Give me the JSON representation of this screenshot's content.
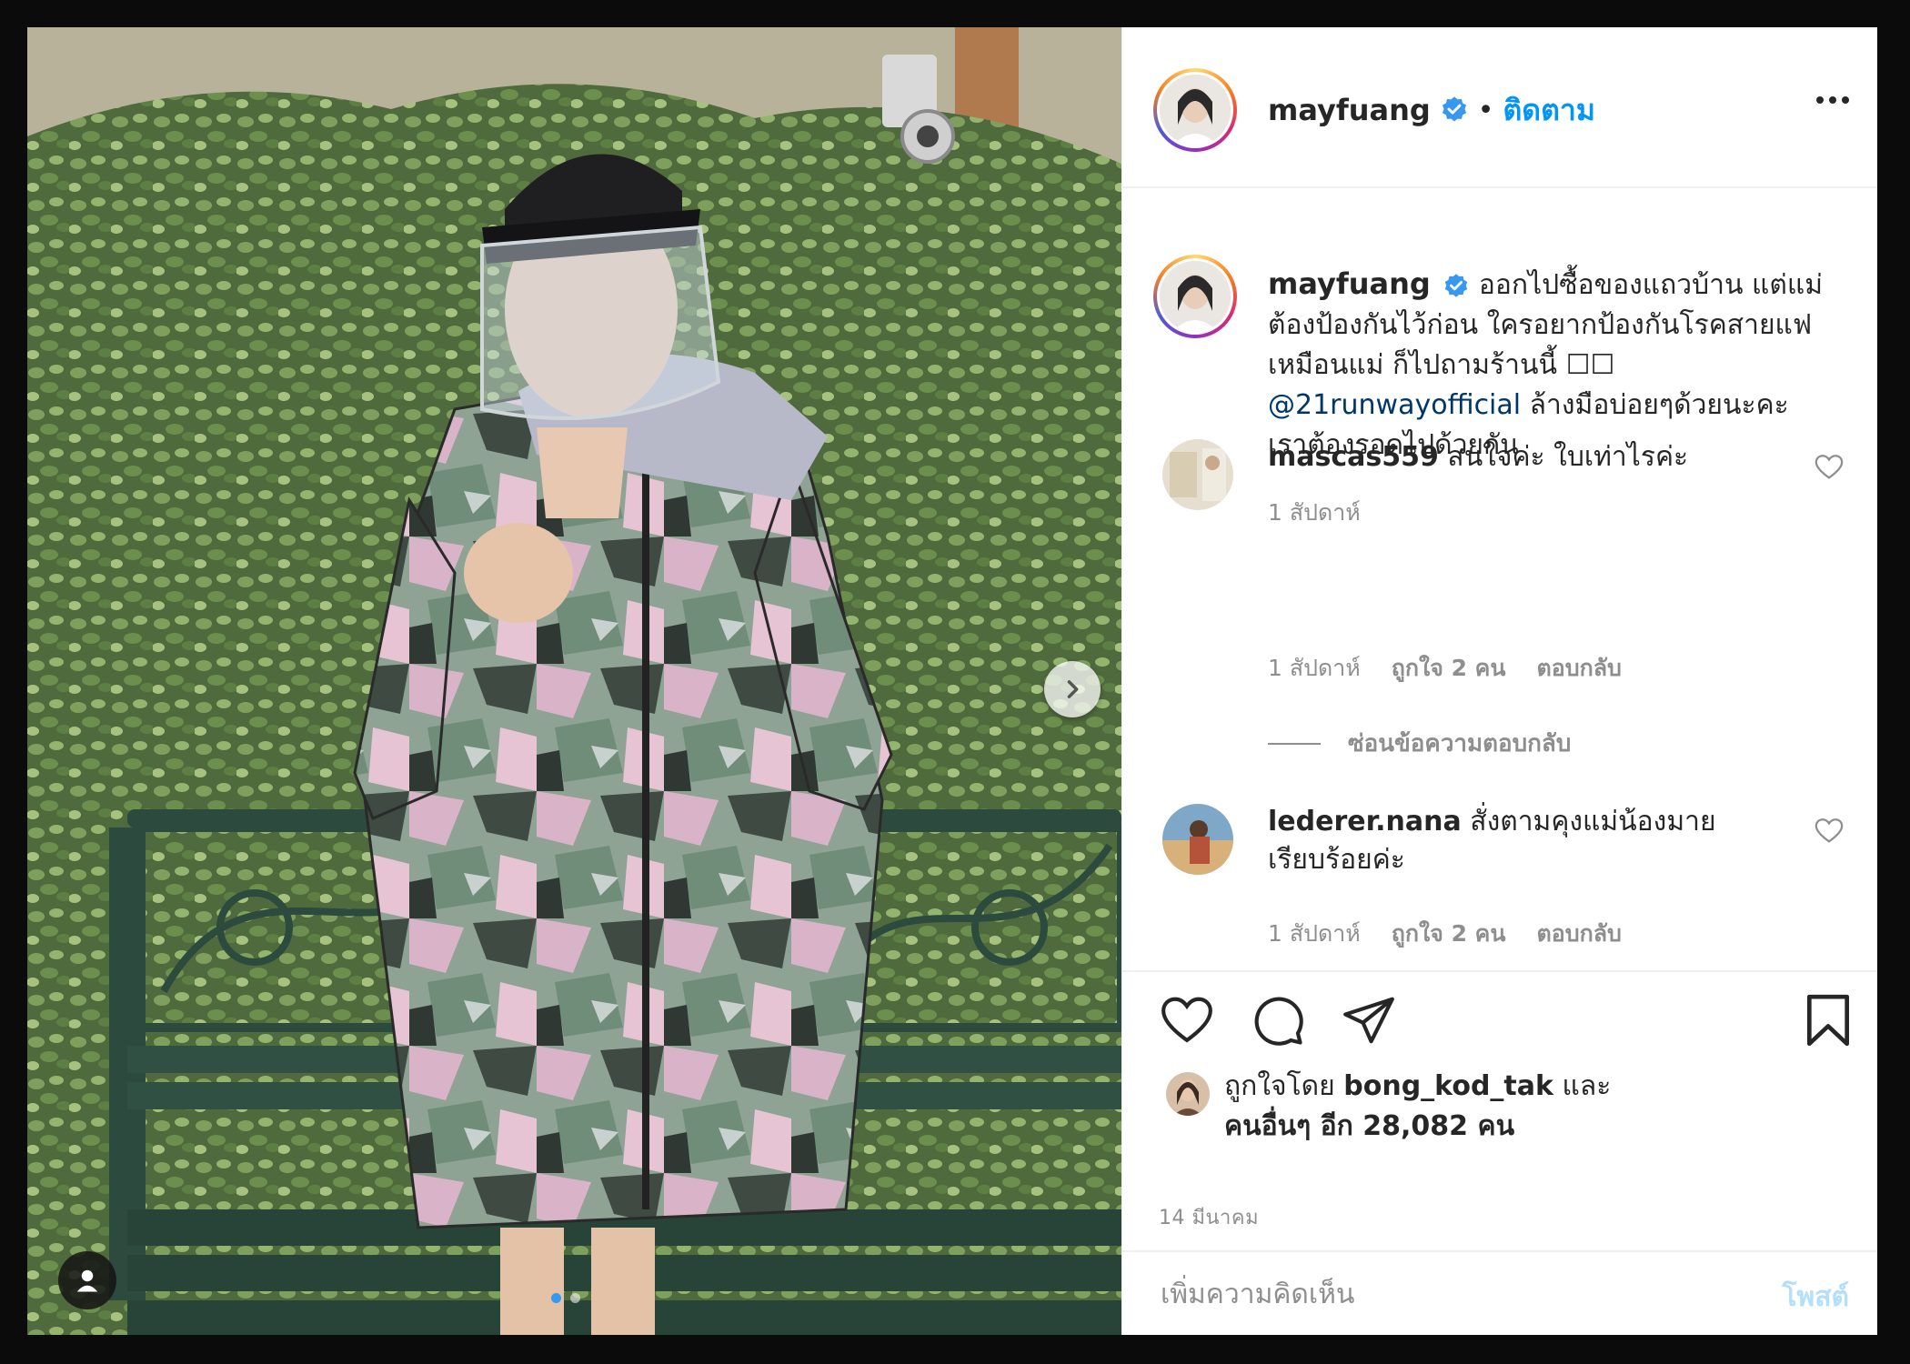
{
  "post": {
    "username": "mayfuang",
    "follow_label": "ติดตาม",
    "separator": "•",
    "caption_body": "ออกไปซื้อของแถวบ้าน แต่แม่ต้องป้องกันไว้ก่อน ใครอยากป้องกันโรคสายแฟเหมือนแม่ ก็ไปถามร้านนี้ ☐☐",
    "caption_mention": "@21runwayofficial",
    "caption_tail": " ล้างมือบ่อยๆด้วยนะคะ เราต้องรอดไปด้วยกัน",
    "caption_time": "1 สัปดาห์"
  },
  "comments": [
    {
      "username": "mascas559",
      "text": "สนใจค่ะ ใบเท่าไรค่ะ",
      "time": "1 สัปดาห์",
      "likes": "ถูกใจ 2 คน",
      "reply": "ตอบกลับ"
    },
    {
      "username": "lederer.nana",
      "text": "สั่งตามคุงแม่น้องมายเรียบร้อยค่ะ",
      "time": "1 สัปดาห์",
      "likes": "ถูกใจ 2 คน",
      "reply": "ตอบกลับ"
    }
  ],
  "hide_replies": "ซ่อนข้อความตอบกลับ",
  "likes": {
    "prefix": "ถูกใจโดย ",
    "user": "bong_kod_tak",
    "mid": " และ",
    "others": "คนอื่นๆ อีก 28,082 คน"
  },
  "post_date": "14 มีนาคม",
  "add_comment": {
    "placeholder": "เพิ่มความคิดเห็น",
    "post_label": "โพสต์"
  },
  "colors": {
    "accent": "#0095f6",
    "verified": "#3897f0",
    "mention": "#00376b",
    "muted": "#8e8e8e"
  },
  "icons": [
    "verified-badge-icon",
    "more-options-icon",
    "heart-icon",
    "comment-icon",
    "share-icon",
    "bookmark-icon",
    "next-arrow-icon",
    "user-tag-icon"
  ]
}
